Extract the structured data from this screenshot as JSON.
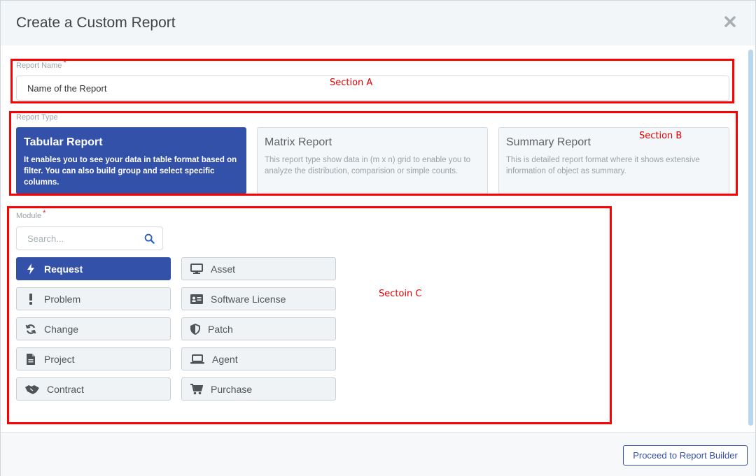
{
  "modal": {
    "title": "Create a Custom Report",
    "close_icon": "close-icon"
  },
  "report_name": {
    "label": "Report Name",
    "required_mark": "*",
    "value": "Name of the Report"
  },
  "report_type": {
    "label": "Report Type",
    "options": [
      {
        "title": "Tabular Report",
        "description": "It enables you to see your data in table format based on filter. You can also build group and select specific columns.",
        "selected": true
      },
      {
        "title": "Matrix Report",
        "description": "This report type show data in (m x n) grid to enable you to analyze the distribution, comparision or simple counts.",
        "selected": false
      },
      {
        "title": "Summary Report",
        "description": "This is detailed report format where it shows extensive information of object as summary.",
        "selected": false
      }
    ]
  },
  "module": {
    "label": "Module",
    "required_mark": "*",
    "search_placeholder": "Search...",
    "search_icon": "search-icon",
    "items": [
      {
        "label": "Request",
        "icon": "bolt-icon",
        "selected": true
      },
      {
        "label": "Asset",
        "icon": "monitor-icon",
        "selected": false
      },
      {
        "label": "Problem",
        "icon": "exclamation-icon",
        "selected": false
      },
      {
        "label": "Software License",
        "icon": "id-card-icon",
        "selected": false
      },
      {
        "label": "Change",
        "icon": "refresh-icon",
        "selected": false
      },
      {
        "label": "Patch",
        "icon": "shield-icon",
        "selected": false
      },
      {
        "label": "Project",
        "icon": "document-icon",
        "selected": false
      },
      {
        "label": "Agent",
        "icon": "laptop-icon",
        "selected": false
      },
      {
        "label": "Contract",
        "icon": "handshake-icon",
        "selected": false
      },
      {
        "label": "Purchase",
        "icon": "cart-icon",
        "selected": false
      }
    ]
  },
  "annotations": {
    "section_a": "Section A",
    "section_b": "Section B",
    "section_c": "Sectoin C"
  },
  "footer": {
    "proceed_label": "Proceed to Report Builder"
  },
  "colors": {
    "accent": "#3451a9",
    "annotation": "#ff0000",
    "header_bg": "#f3f6f8"
  }
}
